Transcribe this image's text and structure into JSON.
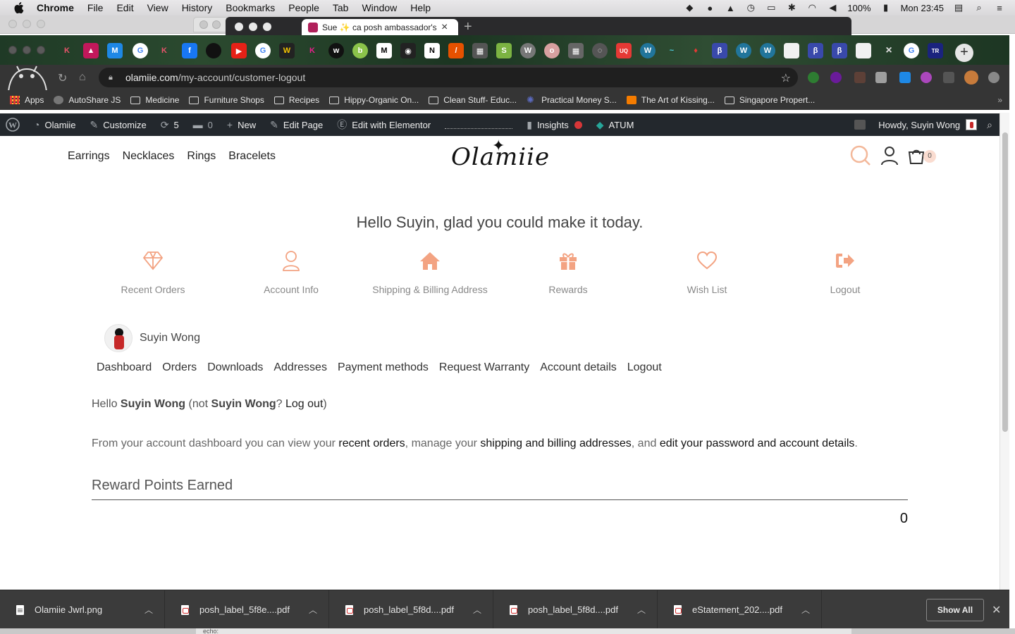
{
  "menubar": {
    "app": "Chrome",
    "items": [
      "File",
      "Edit",
      "View",
      "History",
      "Bookmarks",
      "People",
      "Tab",
      "Window",
      "Help"
    ],
    "battery": "100%",
    "clock": "Mon 23:45"
  },
  "background_tab": {
    "title": "Sue ✨ ca posh ambassador's"
  },
  "toolbar": {
    "url_domain": "olamiie.com",
    "url_path": "/my-account/customer-logout"
  },
  "bookmarks": {
    "items": [
      {
        "label": "Apps",
        "icon": "apps-grid-icon"
      },
      {
        "label": "AutoShare JS",
        "icon": "globe-icon"
      },
      {
        "label": "Medicine",
        "icon": "folder-icon"
      },
      {
        "label": "Furniture Shops",
        "icon": "folder-icon"
      },
      {
        "label": "Recipes",
        "icon": "folder-icon"
      },
      {
        "label": "Hippy-Organic On...",
        "icon": "folder-icon"
      },
      {
        "label": "Clean Stuff- Educ...",
        "icon": "folder-icon"
      },
      {
        "label": "Practical Money S...",
        "icon": "star-burst-icon"
      },
      {
        "label": "The Art of Kissing...",
        "icon": "blogger-icon"
      },
      {
        "label": "Singapore Propert...",
        "icon": "folder-icon"
      }
    ],
    "more": "»"
  },
  "wpbar": {
    "site": "Olamiie",
    "customize": "Customize",
    "updates": "5",
    "comments": "0",
    "new": "New",
    "edit_page": "Edit Page",
    "elementor": "Edit with Elementor",
    "insights": "Insights",
    "atum": "ATUM",
    "howdy": "Howdy, Suyin Wong"
  },
  "site": {
    "nav": [
      "Earrings",
      "Necklaces",
      "Rings",
      "Bracelets"
    ],
    "logo": "Olamiie",
    "cart_count": "0",
    "greeting": "Hello Suyin, glad you could make it today.",
    "account_tiles": [
      {
        "label": "Recent Orders",
        "icon": "diamond-icon"
      },
      {
        "label": "Account Info",
        "icon": "user-icon"
      },
      {
        "label": "Shipping & Billing Address",
        "icon": "home-icon"
      },
      {
        "label": "Rewards",
        "icon": "gift-icon"
      },
      {
        "label": "Wish List",
        "icon": "heart-icon"
      },
      {
        "label": "Logout",
        "icon": "sign-out-icon"
      }
    ],
    "user_name": "Suyin Wong",
    "account_nav": [
      "Dashboard",
      "Orders",
      "Downloads",
      "Addresses",
      "Payment methods",
      "Request Warranty",
      "Account details",
      "Logout"
    ],
    "hello": {
      "prefix": "Hello ",
      "name": "Suyin Wong",
      "mid": " (not ",
      "name2": "Suyin Wong",
      "q": "? ",
      "logout": "Log out",
      "suffix": ")"
    },
    "dashboard": {
      "t1": "From your account dashboard you can view your ",
      "l1": "recent orders",
      "t2": ", manage your ",
      "l2": "shipping and billing addresses",
      "t3": ", and ",
      "l3": "edit your password and account details",
      "t4": "."
    },
    "reward_title": "Reward Points Earned",
    "reward_value": "0"
  },
  "downloads": {
    "items": [
      {
        "name": "Olamiie Jwrl.png",
        "type": "png"
      },
      {
        "name": "posh_label_5f8e....pdf",
        "type": "pdf"
      },
      {
        "name": "posh_label_5f8d....pdf",
        "type": "pdf"
      },
      {
        "name": "posh_label_5f8d....pdf",
        "type": "pdf"
      },
      {
        "name": "eStatement_202....pdf",
        "type": "pdf"
      }
    ],
    "show_all": "Show All"
  },
  "bottom_echo": "echo:",
  "colors": {
    "accent": "#f3a382",
    "wp_bar": "#23282d",
    "chrome_dark": "#353535"
  }
}
